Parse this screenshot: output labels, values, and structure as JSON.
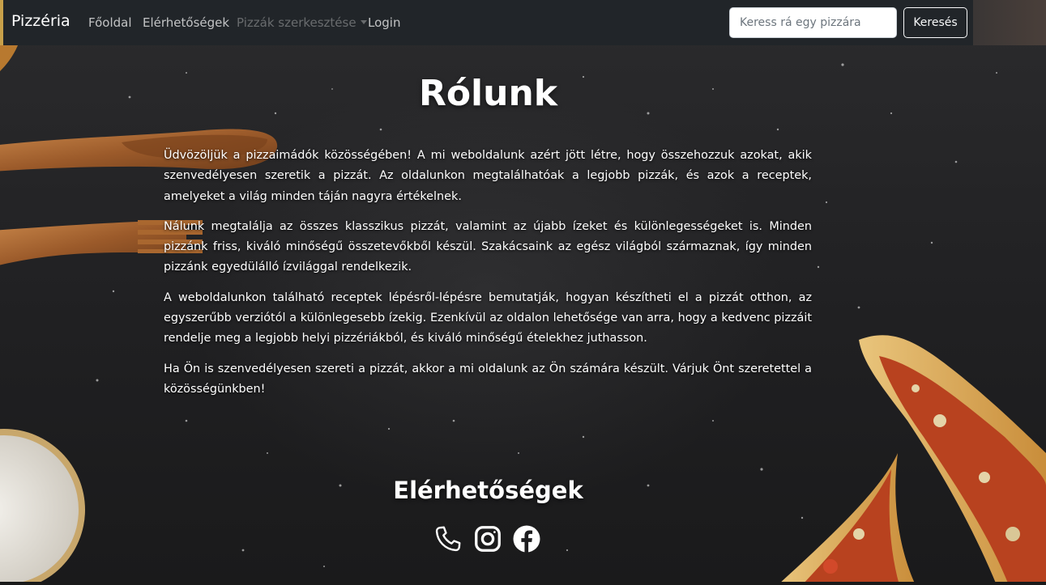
{
  "navbar": {
    "brand": "Pizzéria",
    "links": [
      {
        "label": "Főoldal"
      },
      {
        "label": "Elérhetőségek"
      },
      {
        "label": "Pizzák szerkesztése"
      },
      {
        "label": "Login"
      }
    ],
    "search": {
      "placeholder": "Keress rá egy pizzára",
      "value": "",
      "button_label": "Keresés"
    }
  },
  "about": {
    "title": "Rólunk",
    "paragraphs": [
      "Üdvözöljük a pizzaimádók közösségében! A mi weboldalunk azért jött létre, hogy összehozzuk azokat, akik szenvedélyesen szeretik a pizzát. Az oldalunkon megtalálhatóak a legjobb pizzák, és azok a receptek, amelyeket a világ minden táján nagyra értékelnek.",
      "Nálunk megtalálja az összes klasszikus pizzát, valamint az újabb ízeket és különlegességeket is. Minden pizzánk friss, kiváló minőségű összetevőkből készül. Szakácsaink az egész világból származnak, így minden pizzánk egyedülálló ízvilággal rendelkezik.",
      "A weboldalunkon található receptek lépésről-lépésre bemutatják, hogyan készítheti el a pizzát otthon, az egyszerűbb verziótól a különlegesebb ízekig. Ezenkívül az oldalon lehetősége van arra, hogy a kedvenc pizzáit rendelje meg a legjobb helyi pizzériákból, és kiváló minőségű ételekhez juthasson.",
      "Ha Ön is szenvedélyesen szereti a pizzát, akkor a mi oldalunk az Ön számára készült. Várjuk Önt szeretettel a közösségünkben!"
    ]
  },
  "contact": {
    "title": "Elérhetőségek",
    "icons": [
      "phone-icon",
      "instagram-icon",
      "facebook-icon"
    ]
  }
}
